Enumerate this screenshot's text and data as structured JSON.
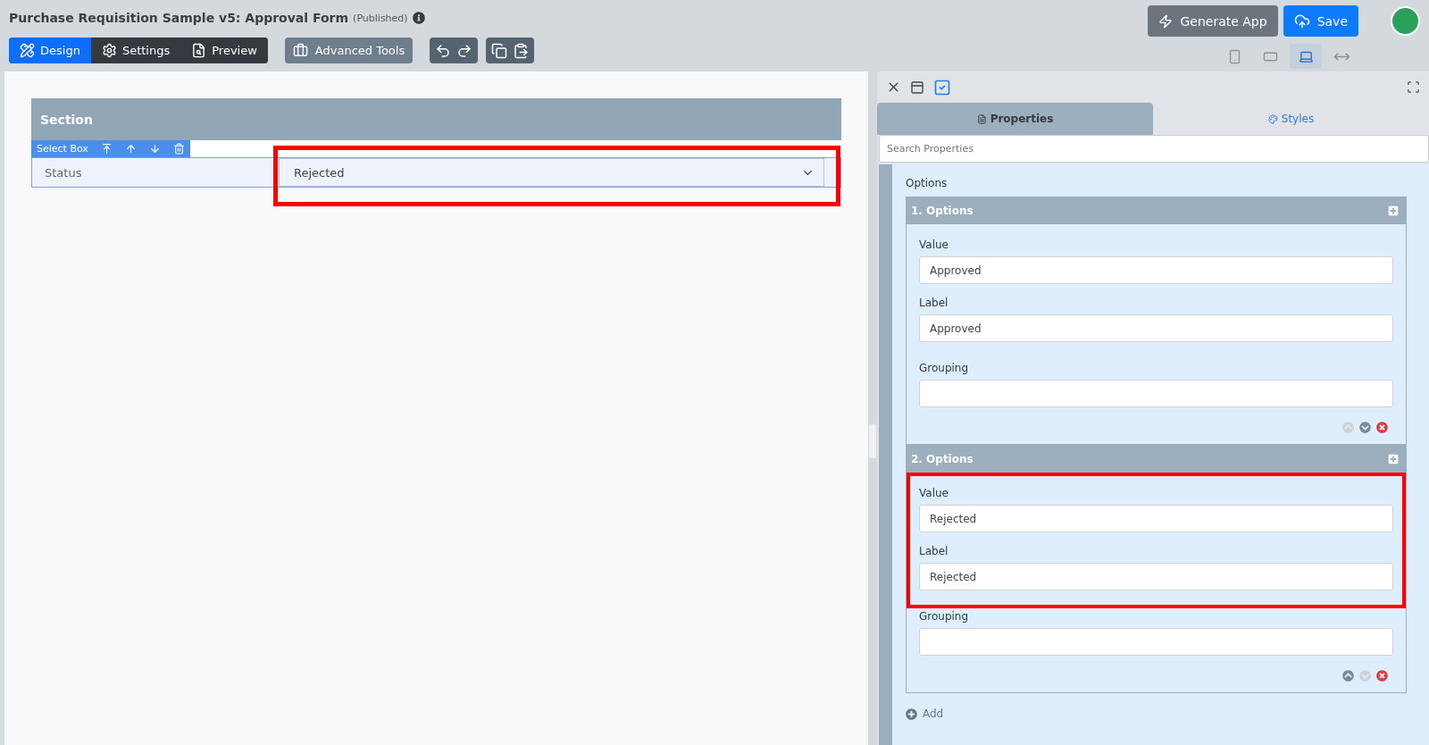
{
  "header": {
    "title": "Purchase Requisition Sample v5: Approval Form",
    "status": "(Published)"
  },
  "mode_tabs": [
    {
      "kind": "design",
      "label": "Design",
      "selected": true
    },
    {
      "kind": "settings",
      "label": "Settings",
      "selected": false
    },
    {
      "kind": "preview",
      "label": "Preview",
      "selected": false
    }
  ],
  "advanced_tools": "Advanced Tools",
  "actions": {
    "generate": "Generate App",
    "save": "Save"
  },
  "devices": [
    {
      "kind": "phone",
      "selected": false
    },
    {
      "kind": "tablet",
      "selected": false
    },
    {
      "kind": "laptop",
      "selected": true
    },
    {
      "kind": "full",
      "selected": false
    }
  ],
  "form": {
    "section": "Section",
    "component_toolbar": "Select Box",
    "field": {
      "label": "Status",
      "value": "Rejected",
      "highlighted": true
    }
  },
  "panel": {
    "tabs": [
      {
        "kind": "properties",
        "label": "Properties",
        "selected": true
      },
      {
        "kind": "styles",
        "label": "Styles",
        "selected": false
      }
    ],
    "search_placeholder": "Search Properties",
    "options_heading": "Options",
    "options": [
      {
        "title": "1. Options",
        "highlighted": false,
        "up_disabled": true,
        "down_disabled": false,
        "fields": [
          {
            "label": "Value",
            "value": "Approved"
          },
          {
            "label": "Label",
            "value": "Approved"
          },
          {
            "label": "Grouping"
          }
        ]
      },
      {
        "title": "2. Options",
        "highlighted": true,
        "up_disabled": false,
        "down_disabled": true,
        "fields": [
          {
            "label": "Value",
            "value": "Rejected"
          },
          {
            "label": "Label",
            "value": "Rejected"
          },
          {
            "label": "Grouping"
          }
        ]
      }
    ],
    "add": "Add"
  }
}
